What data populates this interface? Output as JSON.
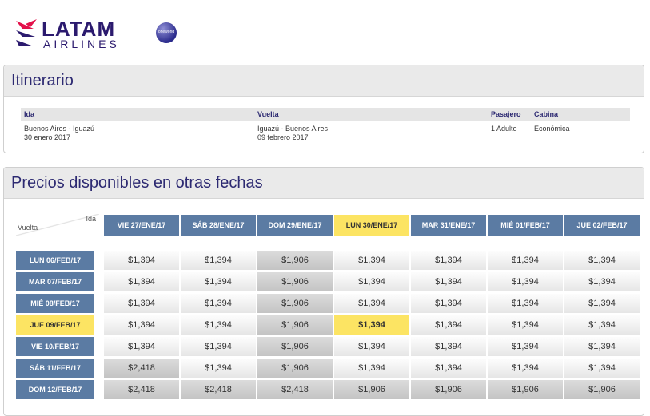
{
  "brand": {
    "name": "LATAM",
    "sub": "AIRLINES",
    "alliance_badge": "oneworld"
  },
  "itinerary": {
    "title": "Itinerario",
    "headers": {
      "ida": "Ida",
      "vuelta": "Vuelta",
      "pasajero": "Pasajero",
      "cabina": "Cabina"
    },
    "ida_route": "Buenos Aires - Iguazú",
    "ida_date": "30 enero 2017",
    "vuelta_route": "Iguazú - Buenos Aires",
    "vuelta_date": "09 febrero 2017",
    "pasajero": "1 Adulto",
    "cabina": "Económica"
  },
  "prices": {
    "title": "Precios disponibles en otras fechas",
    "corner_ida": "Ida",
    "corner_vuelta": "Vuelta",
    "columns": [
      "VIE 27/ENE/17",
      "SÁB 28/ENE/17",
      "DOM 29/ENE/17",
      "LUN 30/ENE/17",
      "MAR 31/ENE/17",
      "MIÉ 01/FEB/17",
      "JUE 02/FEB/17"
    ],
    "selected_column": 3,
    "rows": [
      {
        "label": "LUN 06/FEB/17",
        "values": [
          "$1,394",
          "$1,394",
          "$1,906",
          "$1,394",
          "$1,394",
          "$1,394",
          "$1,394"
        ]
      },
      {
        "label": "MAR 07/FEB/17",
        "values": [
          "$1,394",
          "$1,394",
          "$1,906",
          "$1,394",
          "$1,394",
          "$1,394",
          "$1,394"
        ]
      },
      {
        "label": "MIÉ 08/FEB/17",
        "values": [
          "$1,394",
          "$1,394",
          "$1,906",
          "$1,394",
          "$1,394",
          "$1,394",
          "$1,394"
        ]
      },
      {
        "label": "JUE 09/FEB/17",
        "values": [
          "$1,394",
          "$1,394",
          "$1,906",
          "$1,394",
          "$1,394",
          "$1,394",
          "$1,394"
        ]
      },
      {
        "label": "VIE 10/FEB/17",
        "values": [
          "$1,394",
          "$1,394",
          "$1,906",
          "$1,394",
          "$1,394",
          "$1,394",
          "$1,394"
        ]
      },
      {
        "label": "SÁB 11/FEB/17",
        "values": [
          "$2,418",
          "$1,394",
          "$1,906",
          "$1,394",
          "$1,394",
          "$1,394",
          "$1,394"
        ]
      },
      {
        "label": "DOM 12/FEB/17",
        "values": [
          "$2,418",
          "$2,418",
          "$2,418",
          "$1,906",
          "$1,906",
          "$1,906",
          "$1,906"
        ]
      }
    ],
    "selected_row": 3,
    "colors": {
      "header": "#5b7ba3",
      "selected": "#fce463"
    }
  }
}
